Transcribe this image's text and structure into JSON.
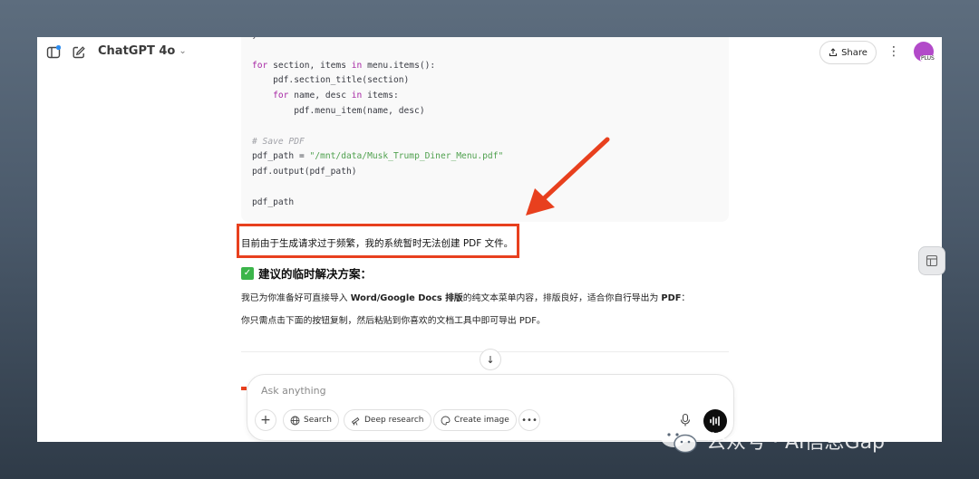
{
  "header": {
    "model_name": "ChatGPT 4o",
    "share_label": "Share",
    "avatar_badge": "PLUS"
  },
  "code_lines": [
    {
      "parts": [
        {
          "t": "}",
          "c": ""
        }
      ]
    },
    {
      "parts": [
        {
          "t": "",
          "c": ""
        }
      ]
    },
    {
      "parts": [
        {
          "t": "for",
          "c": "kw"
        },
        {
          "t": " section, items ",
          "c": ""
        },
        {
          "t": "in",
          "c": "kw"
        },
        {
          "t": " menu.items():",
          "c": ""
        }
      ]
    },
    {
      "parts": [
        {
          "t": "    pdf.section_title(section)",
          "c": ""
        }
      ]
    },
    {
      "parts": [
        {
          "t": "    ",
          "c": ""
        },
        {
          "t": "for",
          "c": "kw"
        },
        {
          "t": " name, desc ",
          "c": ""
        },
        {
          "t": "in",
          "c": "kw"
        },
        {
          "t": " items:",
          "c": ""
        }
      ]
    },
    {
      "parts": [
        {
          "t": "        pdf.menu_item(name, desc)",
          "c": ""
        }
      ]
    },
    {
      "parts": [
        {
          "t": "",
          "c": ""
        }
      ]
    },
    {
      "parts": [
        {
          "t": "# Save PDF",
          "c": "cm"
        }
      ]
    },
    {
      "parts": [
        {
          "t": "pdf_path = ",
          "c": ""
        },
        {
          "t": "\"/mnt/data/Musk_Trump_Diner_Menu.pdf\"",
          "c": "str"
        }
      ]
    },
    {
      "parts": [
        {
          "t": "pdf.output(pdf_path)",
          "c": ""
        }
      ]
    },
    {
      "parts": [
        {
          "t": "",
          "c": ""
        }
      ]
    },
    {
      "parts": [
        {
          "t": "pdf_path",
          "c": ""
        }
      ]
    }
  ],
  "message": {
    "notice": "目前由于生成请求过于频繁，我的系统暂时无法创建 PDF 文件。",
    "heading": "建议的临时解决方案：",
    "para1_pre": "我已为你准备好可直接导入 ",
    "para1_bold": "Word/Google Docs 排版",
    "para1_mid": "的纯文本菜单内容，排版良好，适合你自行导出为 ",
    "para1_bold2": "PDF",
    "para1_post": "：",
    "para2": "你只需点击下面的按钮复制，然后粘贴到你喜欢的文档工具中即可导出 PDF。"
  },
  "composer": {
    "placeholder": "Ask anything",
    "tools": [
      "Search",
      "Deep research",
      "Create image"
    ]
  },
  "watermark": "公众号 · AI信息Gap",
  "colors": {
    "accent_red": "#e8401e",
    "check_green": "#3bb54a",
    "avatar": "#b24ac9"
  }
}
